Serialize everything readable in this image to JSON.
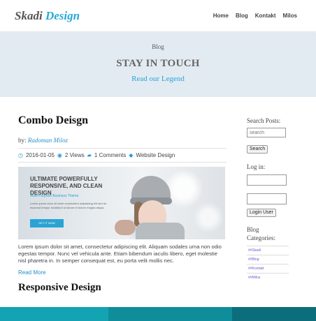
{
  "header": {
    "logo_part1": "Skadi",
    "logo_part2": "Design",
    "nav": [
      "Home",
      "Blog",
      "Kontakt",
      "Milos"
    ]
  },
  "banner": {
    "breadcrumb": "Blog",
    "title": "STAY IN TOUCH",
    "subtitle": "Read our Legend"
  },
  "post": {
    "title": "Combo Deisgn",
    "by_label": "by:",
    "author": "Radoman Miloz",
    "date": "2016-01-05",
    "views": "2 Views",
    "comments": "1 Comments",
    "category": "Website Design",
    "hero": {
      "headline": "ULTIMATE POWERFULLY RESPONSIVE, AND CLEAN DESIGN",
      "tagline": "Multi-Purpose Business Theme",
      "body": "Lorem ipsum dolor sit amet consectetur adipisicing elit sed do eiusmod tempor incididunt ut labore et dolore magna aliqua.",
      "button": "GET IT NOW"
    },
    "excerpt": "Lorem ipsum dolor sit amet, consectetur adipiscing elit. Aliquam sodales urna non odio egestas tempor. Nunc vel vehicula ante. Etiam bibendum iaculis libero, eget molestie nisl pharetra in. In semper consequat est, eu porta velit mollis nec.",
    "read_more": "Read More"
  },
  "post2": {
    "title": "Responsive Design"
  },
  "sidebar": {
    "search_heading": "Search Posts:",
    "search_placeholder": "search",
    "search_button": "Search",
    "login_heading": "Log in:",
    "login_button": "Login User",
    "categories_heading": "Blog Categories:",
    "categories": [
      "##Skadi",
      "##Blog",
      "##Kontakt",
      "##Milos"
    ]
  },
  "footer_colors": [
    "#14a3b2",
    "#0f8d9b",
    "#0b6e7a"
  ],
  "colors": {
    "accent": "#27a9d8",
    "banner_bg": "#e3ebf2"
  },
  "icons": {
    "date": "clock-icon",
    "views": "eye-icon",
    "comments": "comments-icon",
    "category": "tag-icon"
  }
}
